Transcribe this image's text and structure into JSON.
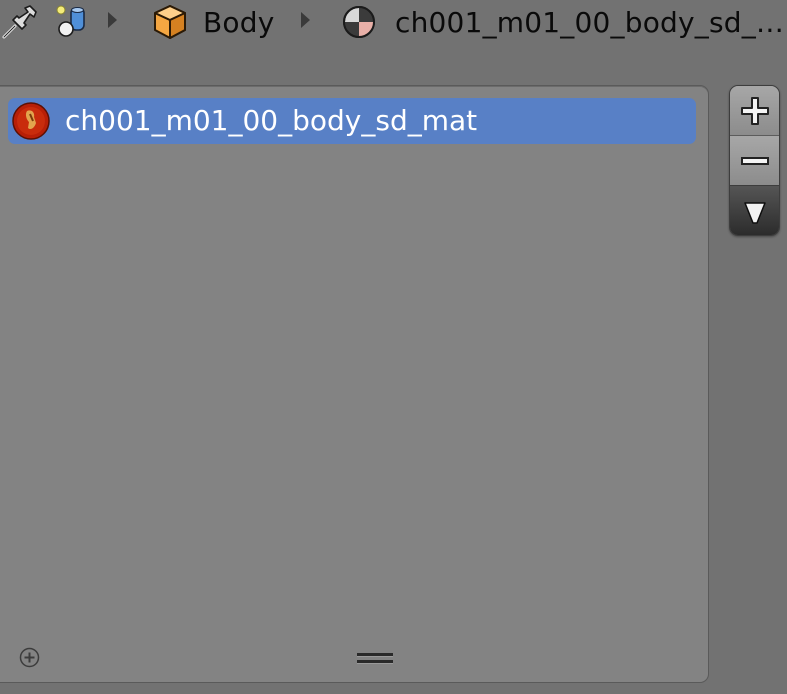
{
  "breadcrumb": {
    "pin_icon": "pin-icon",
    "scene_icon": "scene-objects-icon",
    "object_icon": "object-cube-icon",
    "object_name": "Body",
    "material_icon": "material-sphere-icon",
    "material_name": "ch001_m01_00_body_sd_…",
    "separator_icon": "chevron-right-icon"
  },
  "material_slots": {
    "items": [
      {
        "label": "ch001_m01_00_body_sd_mat",
        "icon": "material-preview-icon",
        "selected": true
      }
    ]
  },
  "side_buttons": {
    "add_icon": "plus-icon",
    "remove_icon": "minus-icon",
    "menu_icon": "dropdown-triangle-icon"
  },
  "footer": {
    "add_icon": "add-circle-icon",
    "grip_icon": "resize-grip-icon"
  },
  "colors": {
    "background": "#727272",
    "list_background": "#838383",
    "selection": "#5880c6"
  }
}
